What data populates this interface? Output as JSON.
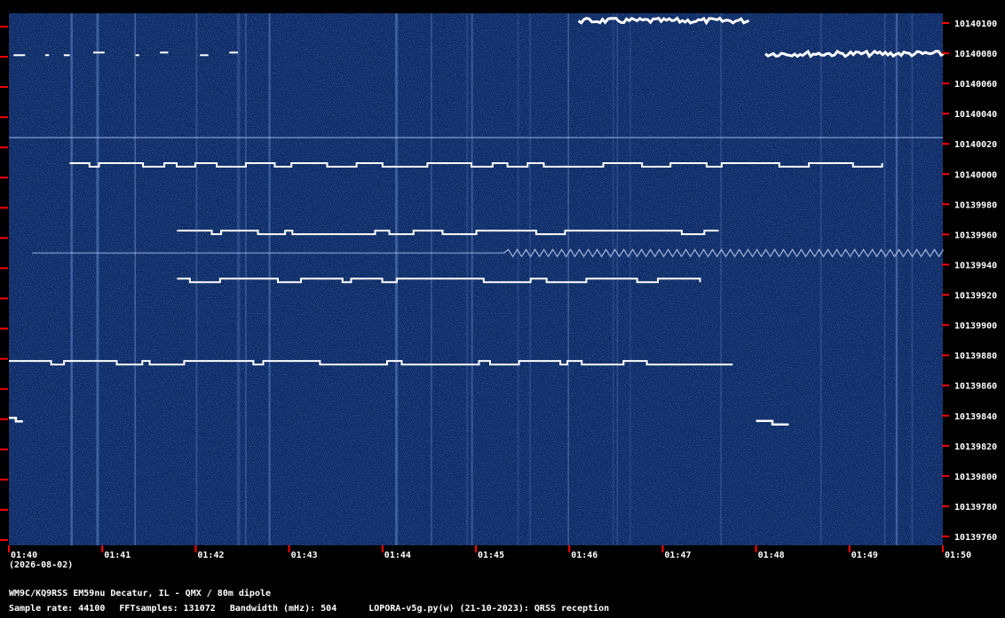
{
  "chart_data": {
    "type": "heatmap",
    "title": "",
    "xlabel": "",
    "ylabel": "",
    "x_ticks": [
      "01:40",
      "01:41",
      "01:42",
      "01:43",
      "01:44",
      "01:45",
      "01:46",
      "01:47",
      "01:48",
      "01:49",
      "01:50"
    ],
    "y_ticks": [
      "10140100",
      "10140080",
      "10140060",
      "10140040",
      "10140020",
      "10140000",
      "10139980",
      "10139960",
      "10139940",
      "10139920",
      "10139900",
      "10139880",
      "10139860",
      "10139840",
      "10139820",
      "10139800",
      "10139780",
      "10139760"
    ],
    "xlim_minutes": [
      0,
      10
    ],
    "ylim_hz": [
      10139755,
      10140110
    ],
    "date": "(2026-08-02)",
    "background_color": "#0b2a66",
    "trace_color": "#ffffff",
    "tick_color": "#ff0000",
    "signals": [
      {
        "start_min": 0.05,
        "end_min": 2.5,
        "freq_hz": 10140082,
        "kind": "dashes"
      },
      {
        "start_min": 6.1,
        "end_min": 7.9,
        "freq_hz": 10140105,
        "kind": "dense"
      },
      {
        "start_min": 8.1,
        "end_min": 10.0,
        "freq_hz": 10140083,
        "kind": "dense"
      },
      {
        "start_min": 0.0,
        "end_min": 10.0,
        "freq_hz": 10140027,
        "kind": "faint"
      },
      {
        "start_min": 0.65,
        "end_min": 9.35,
        "freq_hz": 10140010,
        "kind": "fsk"
      },
      {
        "start_min": 1.8,
        "end_min": 7.6,
        "freq_hz": 10139965,
        "kind": "fsk"
      },
      {
        "start_min": 0.25,
        "end_min": 5.3,
        "freq_hz": 10139950,
        "kind": "faint"
      },
      {
        "start_min": 5.3,
        "end_min": 10.0,
        "freq_hz": 10139950,
        "kind": "zigzag"
      },
      {
        "start_min": 1.8,
        "end_min": 7.4,
        "freq_hz": 10139933,
        "kind": "fsk"
      },
      {
        "start_min": 0.0,
        "end_min": 7.75,
        "freq_hz": 10139878,
        "kind": "fsk"
      },
      {
        "start_min": 0.0,
        "end_min": 0.15,
        "freq_hz": 10139840,
        "kind": "blip"
      },
      {
        "start_min": 8.0,
        "end_min": 8.35,
        "freq_hz": 10139838,
        "kind": "blip"
      }
    ]
  },
  "footer": {
    "station": "WM9C/KQ9RSS EM59nu Decatur, IL - QMX / 80m dipole",
    "sample_rate": "Sample rate: 44100",
    "fft_samples": "FFTsamples: 131072",
    "bandwidth": "Bandwidth (mHz): 504",
    "version": "LOPORA-v5g.py(w) (21-10-2023): QRSS reception"
  }
}
